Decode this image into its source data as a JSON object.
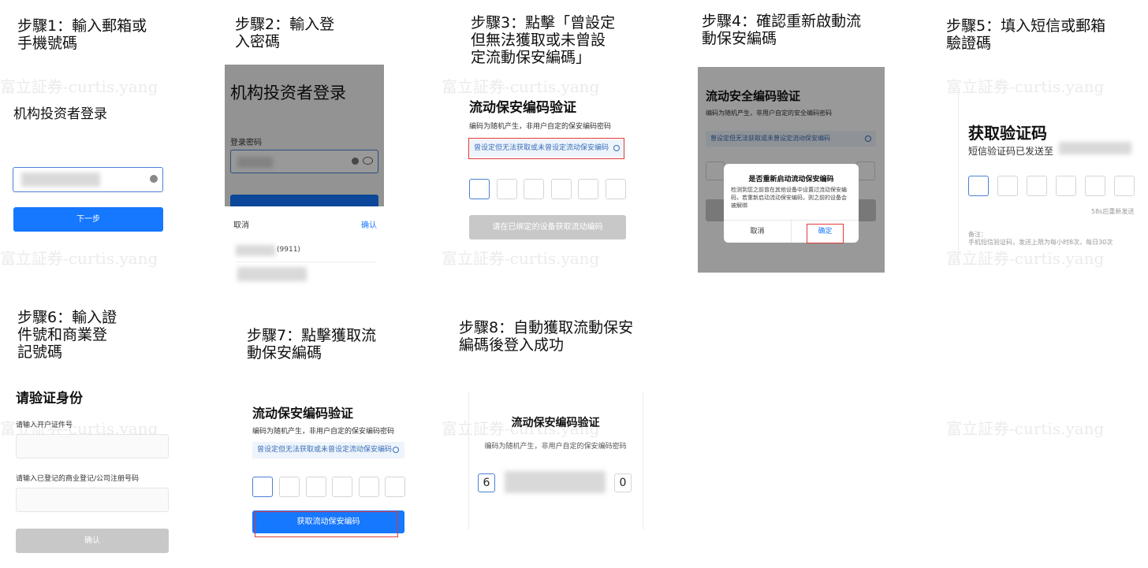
{
  "captions": {
    "s1": "步驟1：輸入郵箱或\n手機號碼",
    "s2": "步驟2：輸入登\n入密碼",
    "s3": "步驟3：點擊「曾設定\n但無法獲取或未曾設\n定流動保安編碼」",
    "s4": "步驟4：確認重新啟動流\n動保安編碼",
    "s5": "步驟5：填入短信或郵箱\n驗證碼",
    "s6": "步驟6：輸入證\n件號和商業登\n記號碼",
    "s7": "步驟7：點擊獲取流\n動保安編碼",
    "s8": "步驟8：自動獲取流動保安\n編碼後登入成功"
  },
  "watermark": "富立証券-curtis.yang",
  "step1": {
    "title": "机构投资者登录",
    "next": "下一步"
  },
  "step2": {
    "title": "机构投资者登录",
    "password_label": "登录密码",
    "cancel": "取消",
    "confirm": "确认",
    "acct_frag": "(9911)"
  },
  "step3": {
    "title": "流动保安编码验证",
    "subtitle": "编码为随机产生，非用户自定的保安编码密码",
    "link": "曾设定但无法获取或未曾设定流动保安编码",
    "button": "请在已绑定的设备获取流动编码"
  },
  "step4": {
    "title": "流动安全编码验证",
    "subtitle": "编码为随机产生，非用户自定的安全编码密码",
    "link": "曾设定但无法获取或未曾设定流动保安编码",
    "dialog_title": "是否重新启动流动保安编码",
    "dialog_body": "检测到您之前曾在其他设备中设置过流动保安编码，若重新启动流动保安编码，则之前的设备会被解绑",
    "cancel": "取消",
    "confirm": "确定"
  },
  "step5": {
    "title": "获取验证码",
    "subtitle": "短信验证码已发送至",
    "resend": "58s后重新发送",
    "note_label": "备注：",
    "note": "手机短信验证码，发送上限为每小时8次，每日30次"
  },
  "step6": {
    "title": "请验证身份",
    "label1": "请输入开户证件号",
    "label2": "请输入已登记的商业登记/公司注册号码",
    "button": "确认"
  },
  "step7": {
    "title": "流动保安编码验证",
    "subtitle": "编码为随机产生，非用户自定的保安编码密码",
    "link": "曾设定但无法获取或未曾设定流动保安编码",
    "button": "获取流动保安编码"
  },
  "step8": {
    "title": "流动保安编码验证",
    "subtitle": "编码为随机产生，非用户自定的保安编码密码",
    "first_digit": "6",
    "last_digit": "0"
  },
  "colors": {
    "primary": "#1677ff",
    "disabled": "#c8c8c8",
    "link_bg": "#eef4fb",
    "highlight": "#e03a3a"
  }
}
